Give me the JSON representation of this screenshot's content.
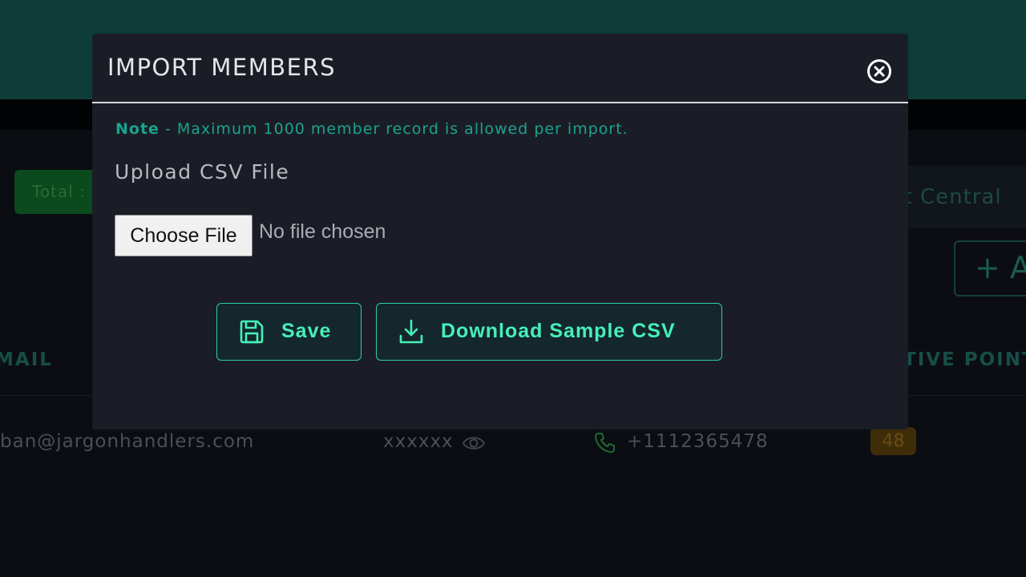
{
  "background": {
    "total_label": "Total :",
    "central_label": "nt Central",
    "add_label": "+ A",
    "columns": {
      "email": "MAIL",
      "points": "TIVE POINT"
    },
    "row": {
      "email": "ban@jargonhandlers.com",
      "password": "xxxxxx",
      "phone": "+1112365478",
      "points": "48"
    }
  },
  "modal": {
    "title": "IMPORT MEMBERS",
    "note_label": "Note",
    "note_text": " - Maximum 1000 member record is allowed per import.",
    "upload_label": "Upload CSV File",
    "choose_file": "Choose File",
    "no_file": "No file chosen",
    "save_label": "Save",
    "download_label": "Download Sample CSV"
  },
  "icons": {
    "close": "close-circle-icon",
    "save": "floppy-disk-icon",
    "download": "download-icon",
    "eye": "eye-icon",
    "phone": "phone-icon"
  },
  "colors": {
    "accent": "#46f0b8",
    "note": "#1aa38e",
    "modal_bg": "#1b1d26",
    "header_bg": "#0d3d36"
  }
}
